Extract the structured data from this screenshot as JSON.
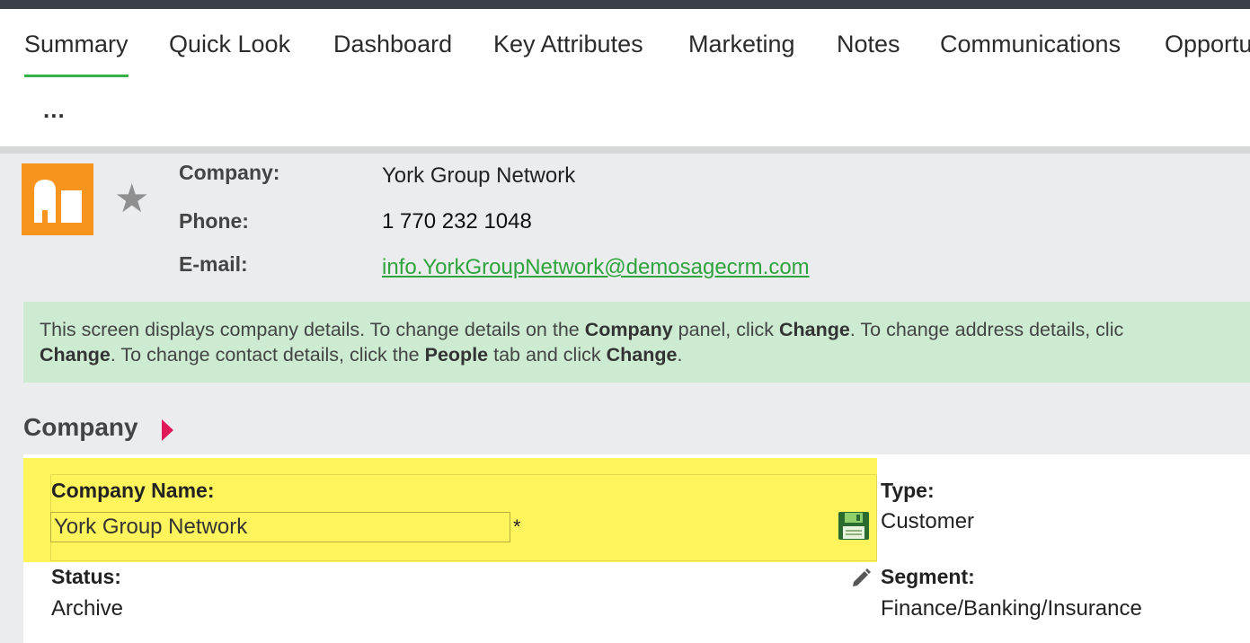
{
  "tabs": [
    "Summary",
    "Quick Look",
    "Dashboard",
    "Key Attributes",
    "Marketing",
    "Notes",
    "Communications",
    "Opportu"
  ],
  "more_label": "...",
  "header": {
    "company_label": "Company:",
    "company_value": "York Group Network",
    "phone_label": "Phone:",
    "phone_value": "1 770 232 1048",
    "email_label": "E-mail:",
    "email_value": "info.YorkGroupNetwork@demosagecrm.com"
  },
  "info": {
    "l1_a": "This screen displays company details. To change details on the ",
    "l1_b": "Company",
    "l1_c": " panel, click ",
    "l1_d": "Change",
    "l1_e": ". To change address details, clic",
    "l2_a": "Change",
    "l2_b": ". To change contact details, click the ",
    "l2_c": "People",
    "l2_d": " tab and click ",
    "l2_e": "Change",
    "l2_f": "."
  },
  "panel": {
    "title": "Company",
    "company_name_label": "Company Name:",
    "company_name_value": "York Group Network",
    "required_mark": "*",
    "type_label": "Type:",
    "type_value": "Customer",
    "status_label": "Status:",
    "status_value": "Archive",
    "segment_label": "Segment:",
    "segment_value": "Finance/Banking/Insurance"
  },
  "colors": {
    "accent_green": "#36b14a",
    "link_green": "#2ea43d",
    "logo_orange": "#f7941d",
    "highlight_yellow": "#fff45c",
    "info_green": "#cdebd0",
    "caret_pink": "#e0195b"
  },
  "icons": {
    "logo": "company-building-icon",
    "favourite": "star-icon",
    "save": "floppy-disk-icon",
    "edit": "pencil-icon",
    "expand": "caret-right-icon"
  }
}
